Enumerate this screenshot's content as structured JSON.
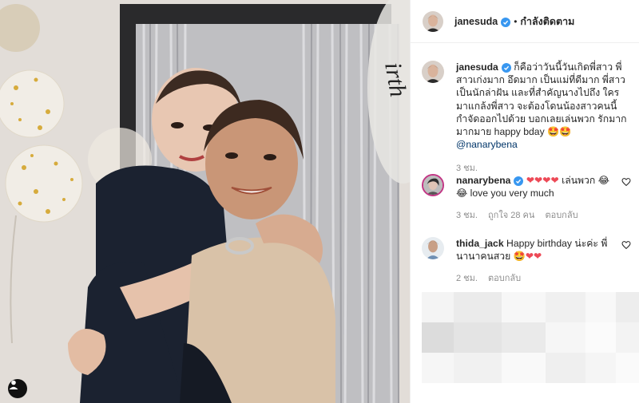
{
  "post": {
    "author": "janesuda",
    "follow_label": "กำลังติดตาม",
    "separator": "•"
  },
  "caption": {
    "user": "janesuda",
    "text": "ก็คือว่าวันนี้วันเกิดพี่สาว พี่สาวเก่งมาก อึดมาก เป็นแม่ที่ดีมาก พี่สาวเป็นนักล่าฝัน และที่สำคัญนางไปถึง ใครมาแกล้งพี่สาว จะต้องโดนน้องสาวคนนี้กำจัดออกไปด้วย บอกเลยเล่นพวก รักมากมากมาย happy bday 🤩🤩",
    "mention": "@nanarybena",
    "time": "3 ชม."
  },
  "comments": [
    {
      "user": "nanarybena",
      "text_before": "เล่นพวก",
      "text_after": "love you very much",
      "time": "3 ชม.",
      "likes": "ถูกใจ 28 คน",
      "reply": "ตอบกลับ"
    },
    {
      "user": "thida_jack",
      "text": "Happy birthday น่ะค่ะ พี่นานาคนสวย",
      "time": "2 ชม.",
      "reply": "ตอบกลับ"
    }
  ],
  "photo_balloon_text": "irth",
  "colors": {
    "verified": "#3897f0",
    "heart": "#ed4956",
    "meta": "#8e8e8e",
    "border": "#efefef"
  },
  "icons": [
    "verified-badge-icon",
    "heart-outline-icon",
    "user-tag-icon",
    "red-heart-emoji",
    "star-eyes-emoji",
    "laughing-emoji"
  ]
}
